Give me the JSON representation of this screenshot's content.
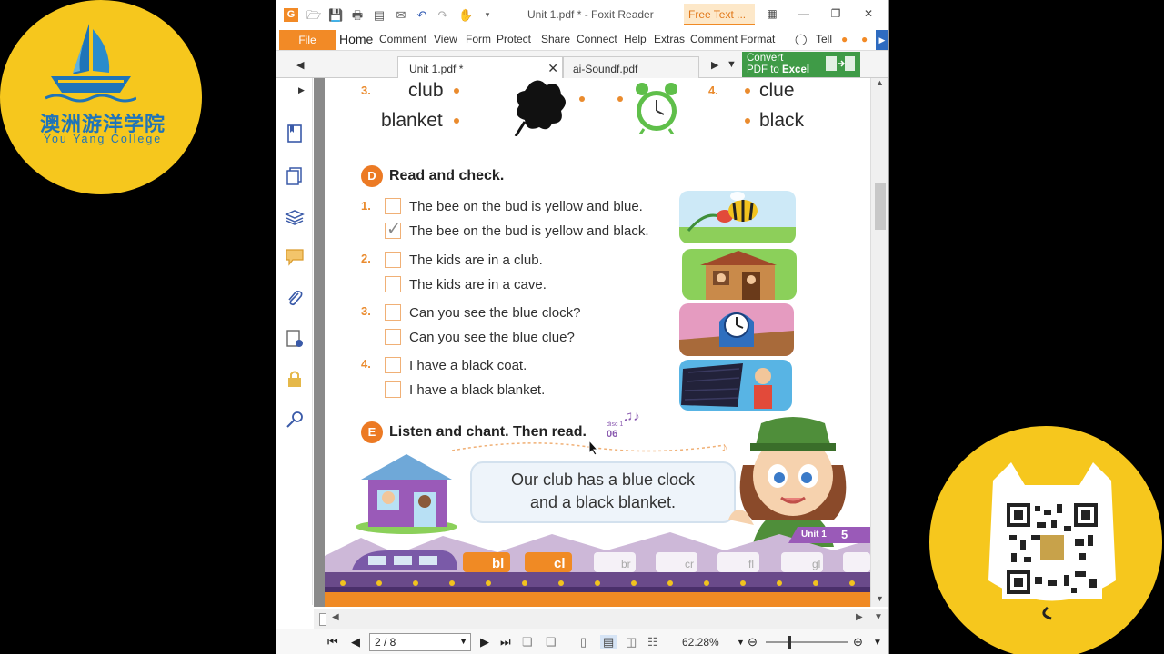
{
  "left_logo": {
    "cn": "澳洲游洋学院",
    "en": "You Yang College"
  },
  "window": {
    "title": "Unit 1.pdf * - Foxit Reader",
    "free_text": "Free Text ...",
    "menu": {
      "file": "File",
      "items": [
        "Home",
        "Comment",
        "View",
        "Form",
        "Protect",
        "Share",
        "Connect",
        "Help",
        "Extras",
        "Comment Format",
        "Tell"
      ]
    },
    "tabs": [
      {
        "label": "Unit 1.pdf *",
        "active": true
      },
      {
        "label": "ai-Soundf.pdf",
        "active": false
      }
    ],
    "convert_ad": {
      "line1": "Convert",
      "line2_prefix": "PDF to ",
      "line2_bold": "Excel"
    },
    "statusbar": {
      "page": "2 / 8",
      "zoom": "62.28%"
    }
  },
  "pdf": {
    "top_words": {
      "num3": "3.",
      "club": "club",
      "blanket": "blanket",
      "num4": "4.",
      "clue": "clue",
      "black": "black"
    },
    "section_d": {
      "badge": "D",
      "title": "Read and check.",
      "items": [
        {
          "num": "1.",
          "options": [
            {
              "text": "The bee on the bud is yellow and blue.",
              "checked": false
            },
            {
              "text": "The bee on the bud is yellow and black.",
              "checked": true
            }
          ]
        },
        {
          "num": "2.",
          "options": [
            {
              "text": "The kids are in a club.",
              "checked": false
            },
            {
              "text": "The kids are in a cave.",
              "checked": false
            }
          ]
        },
        {
          "num": "3.",
          "options": [
            {
              "text": "Can you see the blue clock?",
              "checked": false
            },
            {
              "text": "Can you see the blue clue?",
              "checked": false
            }
          ]
        },
        {
          "num": "4.",
          "options": [
            {
              "text": "I have a black coat.",
              "checked": false
            },
            {
              "text": "I have a black blanket.",
              "checked": false
            }
          ]
        }
      ]
    },
    "section_e": {
      "badge": "E",
      "title": "Listen and chant. Then read.",
      "track_label": "disc 1",
      "track": "06",
      "bubble_line1": "Our club has a blue clock",
      "bubble_line2": "and a black blanket."
    },
    "footer": {
      "unit": "Unit 1",
      "page_num": "5",
      "train_cars": [
        "bl",
        "cl",
        "br",
        "cr",
        "fl",
        "gl"
      ]
    }
  }
}
